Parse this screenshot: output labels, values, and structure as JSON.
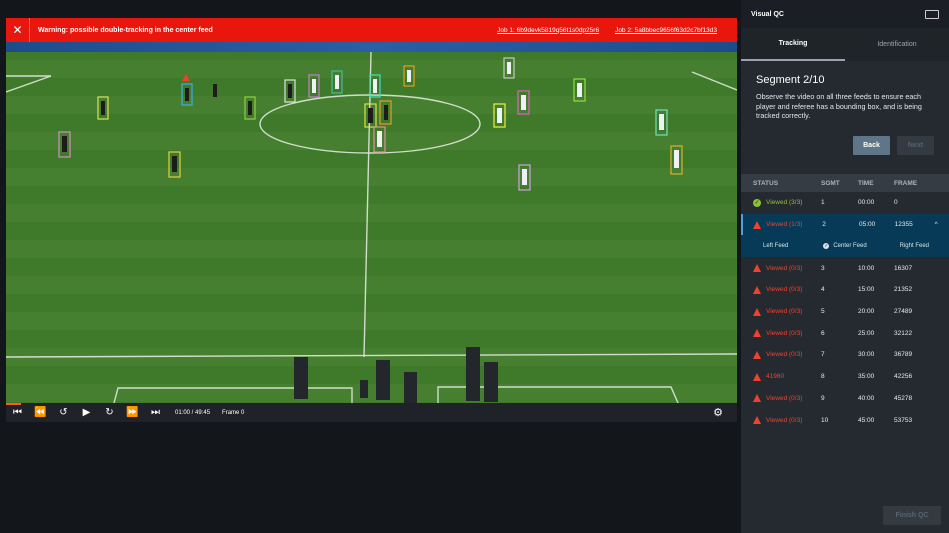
{
  "warning": {
    "message": "Warning: possible double-tracking in the center feed",
    "job1": "Job 1: 6b9devk5819q56t1s0dp25r6",
    "job2": "Job 2: 5a8bbec9656f63d2c7bf13d3"
  },
  "player": {
    "time": "01:00 / 49:45",
    "frame": "Frame 0",
    "progress": 0.0201
  },
  "panel": {
    "title": "Visual QC",
    "tabs": [
      "Tracking",
      "Identification"
    ],
    "active_tab": "Tracking",
    "segment_title": "Segment 2/10",
    "segment_desc": "Observe the video on all three feeds to ensure each player and referee has a bounding box, and is being tracked correctly.",
    "back_label": "Back",
    "next_label": "Next",
    "finish_label": "Finish QC"
  },
  "table": {
    "headers": [
      "STATUS",
      "SGMT",
      "TIME",
      "FRAME"
    ],
    "rows": [
      {
        "status": "Viewed (3/3)",
        "sgmt": "1",
        "time": "00:00",
        "frame": "0",
        "kind": "ok"
      },
      {
        "status": "Viewed (1/3)",
        "sgmt": "2",
        "time": "05:00",
        "frame": "12355",
        "kind": "warn"
      },
      {
        "status": "Viewed (0/3)",
        "sgmt": "3",
        "time": "10:00",
        "frame": "16307",
        "kind": "warn"
      },
      {
        "status": "Viewed (0/3)",
        "sgmt": "4",
        "time": "15:00",
        "frame": "21352",
        "kind": "warn"
      },
      {
        "status": "Viewed (0/3)",
        "sgmt": "5",
        "time": "20:00",
        "frame": "27489",
        "kind": "warn"
      },
      {
        "status": "Viewed (0/3)",
        "sgmt": "6",
        "time": "25:00",
        "frame": "32122",
        "kind": "warn"
      },
      {
        "status": "Viewed (0/3)",
        "sgmt": "7",
        "time": "30:00",
        "frame": "36789",
        "kind": "warn"
      },
      {
        "status": "41960",
        "sgmt": "8",
        "time": "35:00",
        "frame": "42256",
        "kind": "warn"
      },
      {
        "status": "Viewed (0/3)",
        "sgmt": "9",
        "time": "40:00",
        "frame": "45278",
        "kind": "warn"
      },
      {
        "status": "Viewed (0/3)",
        "sgmt": "10",
        "time": "45:00",
        "frame": "53753",
        "kind": "warn"
      }
    ],
    "feeds": {
      "left": "Left Feed",
      "center": "Center Feed",
      "right": "Right Feed"
    }
  },
  "colors": {
    "warning_bar": "#e8160c",
    "ok": "#8ec233",
    "warn": "#f0412e",
    "active_row": "#063a57",
    "progress": "#ff5a1f"
  }
}
